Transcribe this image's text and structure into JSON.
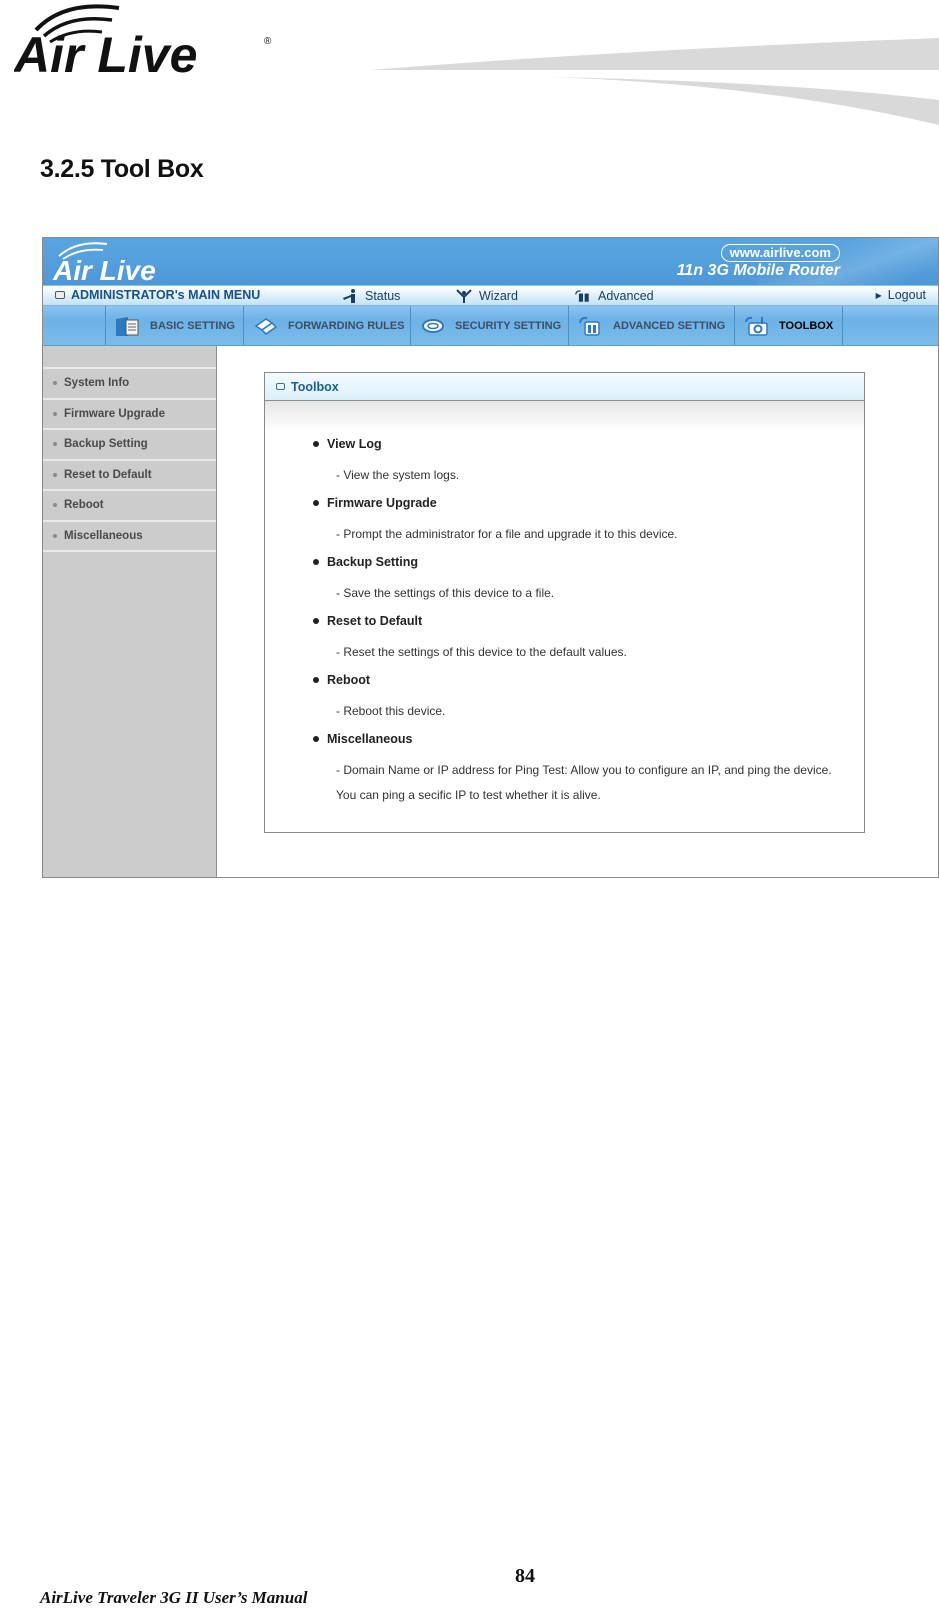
{
  "doc": {
    "brand": "Air Live",
    "section_title": "3.2.5 Tool Box",
    "footer_manual": "AirLive Traveler 3G II User’s Manual",
    "page_number": "84"
  },
  "router_ui": {
    "banner": {
      "brand": "Air Live",
      "site": "www.airlive.com",
      "product": "11n 3G Mobile Router"
    },
    "main_menu": {
      "title": "ADMINISTRATOR's MAIN MENU",
      "items": [
        {
          "label": "Status",
          "icon": "status-person-icon"
        },
        {
          "label": "Wizard",
          "icon": "wizard-icon"
        },
        {
          "label": "Advanced",
          "icon": "advanced-icon"
        }
      ],
      "logout": "Logout"
    },
    "tabs": [
      {
        "label": "BASIC SETTING",
        "icon": "folder-document-icon",
        "active": false
      },
      {
        "label": "FORWARDING RULES",
        "icon": "forwarding-arrows-icon",
        "active": false
      },
      {
        "label": "SECURITY SETTING",
        "icon": "lock-icon",
        "active": false
      },
      {
        "label": "ADVANCED SETTING",
        "icon": "advanced-setting-icon",
        "active": false
      },
      {
        "label": "TOOLBOX",
        "icon": "toolbox-gear-icon",
        "active": true
      }
    ],
    "sidebar": {
      "items": [
        {
          "label": "System Info"
        },
        {
          "label": "Firmware Upgrade"
        },
        {
          "label": "Backup Setting"
        },
        {
          "label": "Reset to Default"
        },
        {
          "label": "Reboot"
        },
        {
          "label": "Miscellaneous"
        }
      ]
    },
    "panel": {
      "title": "Toolbox",
      "entries": [
        {
          "title": "View Log",
          "desc": "- View the system logs."
        },
        {
          "title": "Firmware Upgrade",
          "desc": "- Prompt the administrator for a file and upgrade it to this device."
        },
        {
          "title": "Backup Setting",
          "desc": "- Save the settings of this device to a file."
        },
        {
          "title": "Reset to Default",
          "desc": "- Reset the settings of this device to the default values."
        },
        {
          "title": "Reboot",
          "desc": "- Reboot this device."
        },
        {
          "title": "Miscellaneous",
          "desc": "- Domain Name or IP address for Ping Test: Allow you to configure an IP, and ping the device. You can ping a secific IP to test whether it is alive."
        }
      ]
    }
  }
}
